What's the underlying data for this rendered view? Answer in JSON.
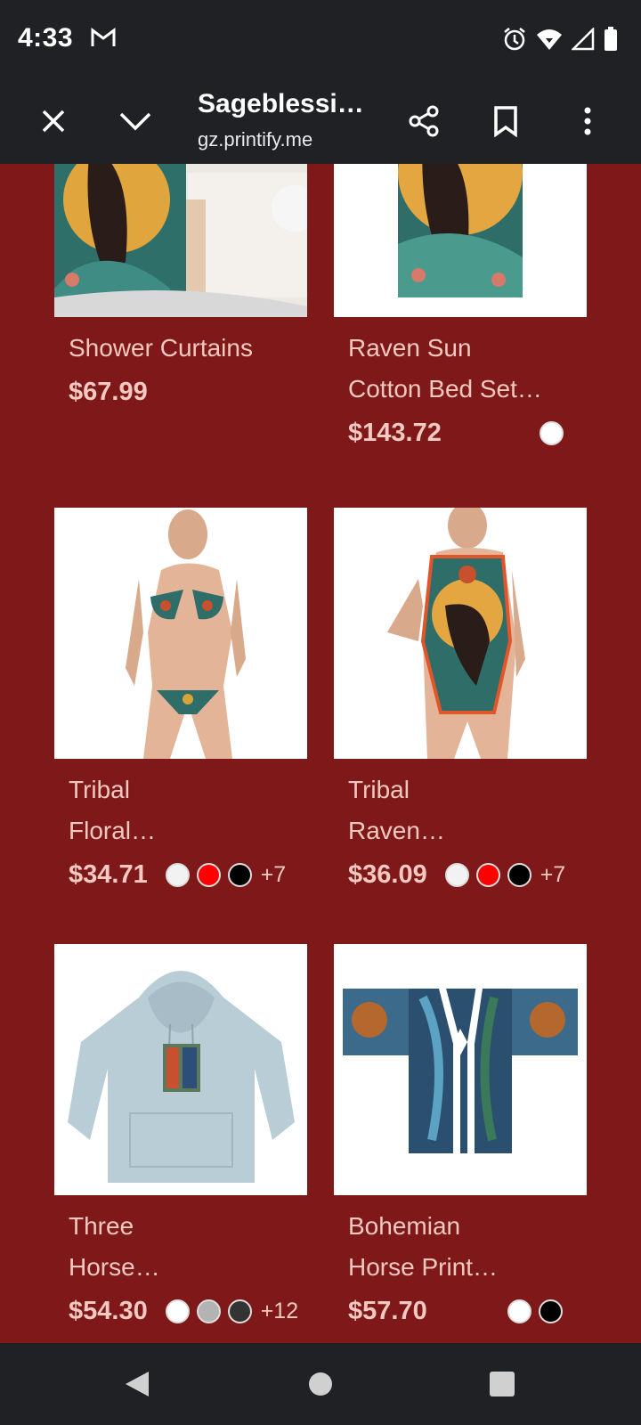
{
  "status": {
    "time": "4:33"
  },
  "toolbar": {
    "title": "Sageblessi…",
    "url": "gz.printify.me"
  },
  "products": [
    {
      "name_lines": [
        "Shower Curtains"
      ],
      "price": "$67.99",
      "swatches": [],
      "more": ""
    },
    {
      "name_lines": [
        "Raven Sun",
        "Cotton Bed Set…"
      ],
      "price": "$143.72",
      "swatches": [
        "#ffffff"
      ],
      "more": ""
    },
    {
      "name_lines": [
        "Tribal",
        "Floral…"
      ],
      "price": "$34.71",
      "swatches": [
        "#f2f2f2",
        "#ff0000",
        "#000000"
      ],
      "more": "+7"
    },
    {
      "name_lines": [
        "Tribal",
        "Raven…"
      ],
      "price": "$36.09",
      "swatches": [
        "#f2f2f2",
        "#ff0000",
        "#000000"
      ],
      "more": "+7"
    },
    {
      "name_lines": [
        "Three",
        "Horse…"
      ],
      "price": "$54.30",
      "swatches": [
        "#ffffff",
        "#b3b3b3",
        "#333333"
      ],
      "more": "+12"
    },
    {
      "name_lines": [
        "Bohemian",
        "Horse Print…"
      ],
      "price": "$57.70",
      "swatches": [
        "#ffffff",
        "#000000"
      ],
      "more": ""
    }
  ],
  "colors": {
    "page_bg": "#7f1919",
    "bar_bg": "#202124",
    "text": "#f1c8c0"
  }
}
